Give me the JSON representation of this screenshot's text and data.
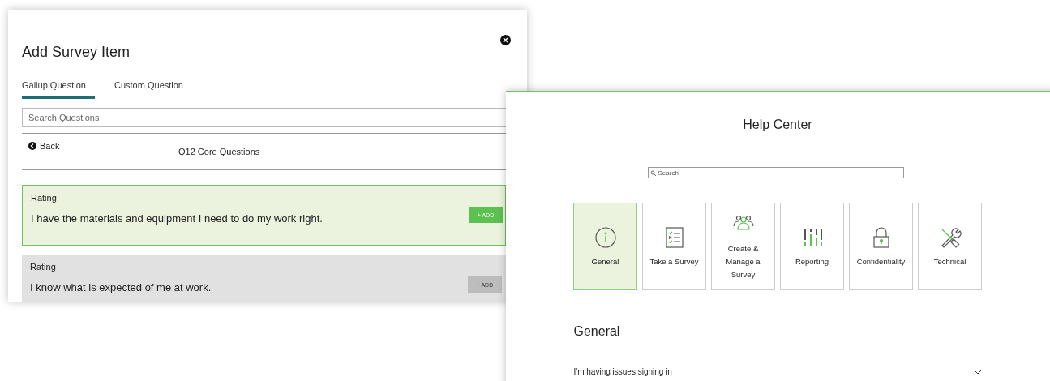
{
  "survey_dialog": {
    "title": "Add Survey Item",
    "tabs": [
      {
        "label": "Gallup Question",
        "selected": true
      },
      {
        "label": "Custom Question",
        "selected": false
      }
    ],
    "search": {
      "placeholder": "Search Questions"
    },
    "back": "Back",
    "section_title": "Q12 Core Questions",
    "items": [
      {
        "type": "Rating",
        "text": "I have the materials and equipment I need to do my work right.",
        "button": "+ ADD",
        "selected": true
      },
      {
        "type": "Rating",
        "text": "I know what is expected of me at work.",
        "button": "+ ADD",
        "selected": false
      }
    ]
  },
  "help_center": {
    "title": "Help Center",
    "search": {
      "placeholder": "Search"
    },
    "categories": [
      {
        "label": "General",
        "kind": "info",
        "selected": true
      },
      {
        "label": "Take a Survey",
        "kind": "checklist",
        "selected": false
      },
      {
        "label": "Create & Manage a Survey",
        "kind": "people",
        "selected": false
      },
      {
        "label": "Reporting",
        "kind": "bars",
        "selected": false
      },
      {
        "label": "Confidentiality",
        "kind": "lock",
        "selected": false
      },
      {
        "label": "Technical",
        "kind": "tools",
        "selected": false
      }
    ],
    "section_title": "General",
    "questions": [
      {
        "text": "I'm having issues signing in",
        "expanded": false
      }
    ]
  }
}
